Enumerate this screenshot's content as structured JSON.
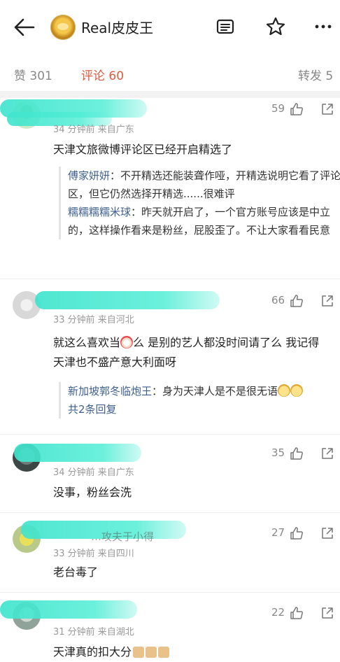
{
  "header": {
    "title": "Real皮皮王",
    "back_icon": "arrow-left-icon",
    "icons": [
      "list-icon",
      "star-icon",
      "more-icon"
    ]
  },
  "tabs": {
    "like": "赞 301",
    "comment": "评论 60",
    "repost": "转发 5"
  },
  "colors": {
    "accent": "#e0593f",
    "link": "#3d5f8f",
    "highlight": "#40e4cd"
  },
  "comments": [
    {
      "meta": "34 分钟前  来自广东",
      "likes": "59",
      "text": "天津文旅微博评论区已经开启精选了",
      "replies": [
        {
          "author": "傅家妍妍",
          "text": "：不开精选还能装聋作哑，开精选说明它看了评论区，但它仍然选择开精选......很难评"
        },
        {
          "author": "糯糯糯糯米球",
          "text": "：昨天就开启了，一个官方账号应该是中立的，这样操作看来是粉丝，屁股歪了。不让大家看看民意"
        }
      ]
    },
    {
      "meta": "33 分钟前  来自河北",
      "likes": "66",
      "text_a": "就这么喜欢当",
      "text_b": "么 是别的艺人都没时间请了么 我记得天津也不盛产意大利面呀",
      "replies": [
        {
          "author": "新加坡郭冬临炮王",
          "text": "：身为天津人是不是很无语"
        }
      ],
      "reply_count": "共2条回复"
    },
    {
      "meta": "34 分钟前  来自广东",
      "likes": "35",
      "text": "没事，粉丝会洗"
    },
    {
      "name_partial": "…攻夫于小得",
      "meta": "33 分钟前  来自四川",
      "likes": "27",
      "text": "老台毒了"
    },
    {
      "meta": "31 分钟前  来自湖北",
      "likes": "22",
      "text": "天津真的扣大分"
    }
  ]
}
